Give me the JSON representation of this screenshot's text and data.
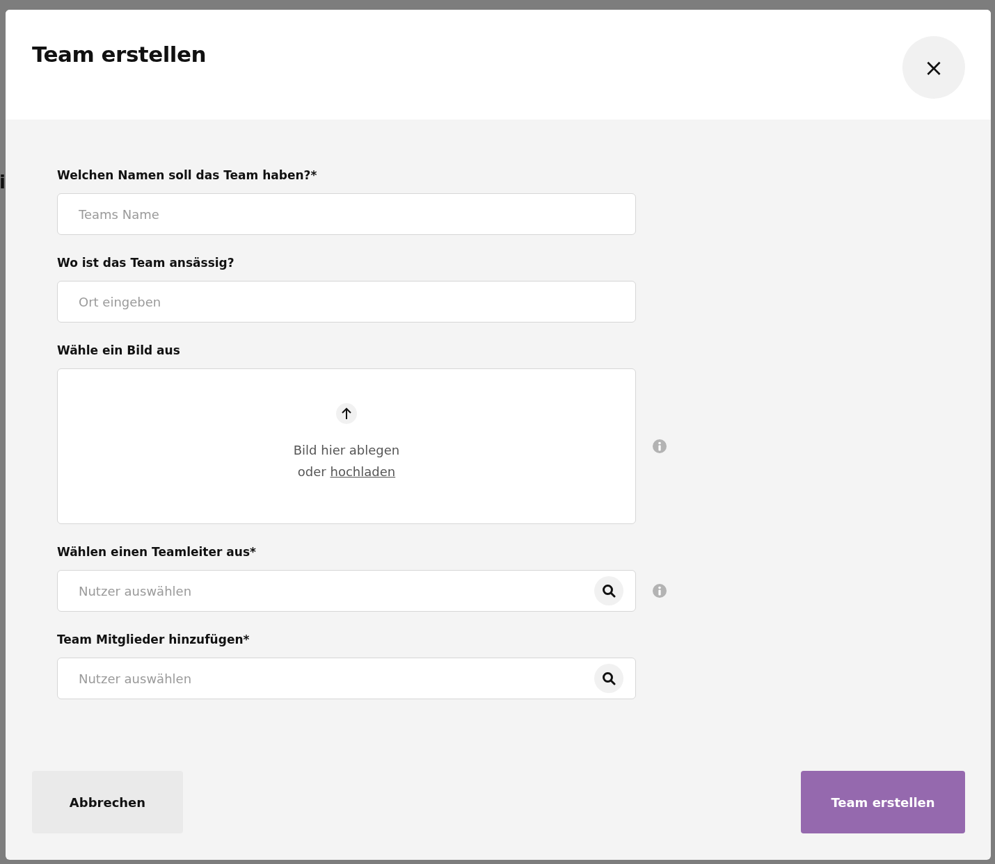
{
  "backdrop": {
    "text": "i"
  },
  "dialog": {
    "title": "Team erstellen",
    "close": "×"
  },
  "fields": [
    {
      "kind": "text",
      "label": "Welchen Namen soll das Team haben?*",
      "placeholder": "Teams Name",
      "info": false
    },
    {
      "kind": "text",
      "label": "Wo ist das Team ansässig?",
      "placeholder": "Ort eingeben",
      "info": false
    },
    {
      "kind": "upload",
      "label": "Wähle ein Bild aus",
      "drop_text": "Bild hier ablegen",
      "or_text": "oder",
      "link": "hochladen",
      "info": true
    },
    {
      "kind": "search",
      "label": "Wählen einen Teamleiter aus*",
      "placeholder": "Nutzer auswählen",
      "info": true
    },
    {
      "kind": "search",
      "label": "Team Mitglieder hinzufügen*",
      "placeholder": "Nutzer auswählen",
      "info": false
    }
  ],
  "buttons": {
    "cancel": "Abbrechen",
    "submit": "Team erstellen"
  }
}
